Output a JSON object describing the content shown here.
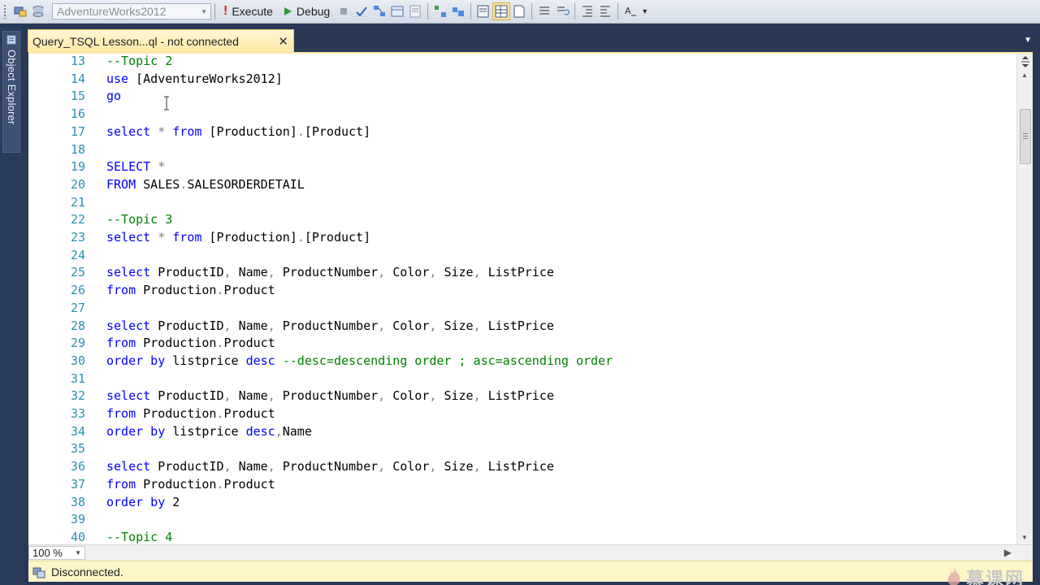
{
  "toolbar": {
    "database_value": "AdventureWorks2012",
    "execute_label": "Execute",
    "debug_label": "Debug"
  },
  "sidebar": {
    "object_explorer_label": "Object Explorer"
  },
  "tab": {
    "title": "Query_TSQL Lesson...ql - not connected",
    "close_glyph": "✕"
  },
  "editor": {
    "lines": [
      {
        "no": "13",
        "tokens": [
          {
            "t": "--Topic 2",
            "c": "cm"
          }
        ]
      },
      {
        "no": "14",
        "tokens": [
          {
            "t": "use",
            "c": "kw"
          },
          {
            "t": " ",
            "c": "tx"
          },
          {
            "t": "[AdventureWorks2012]",
            "c": "tx"
          }
        ]
      },
      {
        "no": "15",
        "tokens": [
          {
            "t": "go",
            "c": "kw"
          }
        ]
      },
      {
        "no": "16",
        "tokens": []
      },
      {
        "no": "17",
        "tokens": [
          {
            "t": "select",
            "c": "kw"
          },
          {
            "t": " * ",
            "c": "gr"
          },
          {
            "t": "from",
            "c": "kw"
          },
          {
            "t": " [Production]",
            "c": "tx"
          },
          {
            "t": ".",
            "c": "gr"
          },
          {
            "t": "[Product]",
            "c": "tx"
          }
        ]
      },
      {
        "no": "18",
        "tokens": []
      },
      {
        "no": "19",
        "tokens": [
          {
            "t": "SELECT",
            "c": "kw"
          },
          {
            "t": " *",
            "c": "gr"
          }
        ]
      },
      {
        "no": "20",
        "tokens": [
          {
            "t": "FROM",
            "c": "kw"
          },
          {
            "t": " SALES",
            "c": "tx"
          },
          {
            "t": ".",
            "c": "gr"
          },
          {
            "t": "SALESORDERDETAIL",
            "c": "tx"
          }
        ]
      },
      {
        "no": "21",
        "tokens": []
      },
      {
        "no": "22",
        "tokens": [
          {
            "t": "--Topic 3",
            "c": "cm"
          }
        ]
      },
      {
        "no": "23",
        "tokens": [
          {
            "t": "select",
            "c": "kw"
          },
          {
            "t": " * ",
            "c": "gr"
          },
          {
            "t": "from",
            "c": "kw"
          },
          {
            "t": " [Production]",
            "c": "tx"
          },
          {
            "t": ".",
            "c": "gr"
          },
          {
            "t": "[Product]",
            "c": "tx"
          }
        ]
      },
      {
        "no": "24",
        "tokens": []
      },
      {
        "no": "25",
        "tokens": [
          {
            "t": "select",
            "c": "kw"
          },
          {
            "t": " ProductID",
            "c": "tx"
          },
          {
            "t": ", ",
            "c": "gr"
          },
          {
            "t": "Name",
            "c": "tx"
          },
          {
            "t": ", ",
            "c": "gr"
          },
          {
            "t": "ProductNumber",
            "c": "tx"
          },
          {
            "t": ", ",
            "c": "gr"
          },
          {
            "t": "Color",
            "c": "tx"
          },
          {
            "t": ", ",
            "c": "gr"
          },
          {
            "t": "Size",
            "c": "tx"
          },
          {
            "t": ", ",
            "c": "gr"
          },
          {
            "t": "ListPrice",
            "c": "tx"
          }
        ]
      },
      {
        "no": "26",
        "tokens": [
          {
            "t": "from",
            "c": "kw"
          },
          {
            "t": " Production",
            "c": "tx"
          },
          {
            "t": ".",
            "c": "gr"
          },
          {
            "t": "Product",
            "c": "tx"
          }
        ]
      },
      {
        "no": "27",
        "tokens": []
      },
      {
        "no": "28",
        "tokens": [
          {
            "t": "select",
            "c": "kw"
          },
          {
            "t": " ProductID",
            "c": "tx"
          },
          {
            "t": ", ",
            "c": "gr"
          },
          {
            "t": "Name",
            "c": "tx"
          },
          {
            "t": ", ",
            "c": "gr"
          },
          {
            "t": "ProductNumber",
            "c": "tx"
          },
          {
            "t": ", ",
            "c": "gr"
          },
          {
            "t": "Color",
            "c": "tx"
          },
          {
            "t": ", ",
            "c": "gr"
          },
          {
            "t": "Size",
            "c": "tx"
          },
          {
            "t": ", ",
            "c": "gr"
          },
          {
            "t": "ListPrice",
            "c": "tx"
          }
        ]
      },
      {
        "no": "29",
        "tokens": [
          {
            "t": "from",
            "c": "kw"
          },
          {
            "t": " Production",
            "c": "tx"
          },
          {
            "t": ".",
            "c": "gr"
          },
          {
            "t": "Product",
            "c": "tx"
          }
        ]
      },
      {
        "no": "30",
        "tokens": [
          {
            "t": "order by",
            "c": "kw"
          },
          {
            "t": " listprice ",
            "c": "tx"
          },
          {
            "t": "desc",
            "c": "kw"
          },
          {
            "t": " --desc=descending order ; asc=ascending order",
            "c": "cm"
          }
        ]
      },
      {
        "no": "31",
        "tokens": []
      },
      {
        "no": "32",
        "tokens": [
          {
            "t": "select",
            "c": "kw"
          },
          {
            "t": " ProductID",
            "c": "tx"
          },
          {
            "t": ", ",
            "c": "gr"
          },
          {
            "t": "Name",
            "c": "tx"
          },
          {
            "t": ", ",
            "c": "gr"
          },
          {
            "t": "ProductNumber",
            "c": "tx"
          },
          {
            "t": ", ",
            "c": "gr"
          },
          {
            "t": "Color",
            "c": "tx"
          },
          {
            "t": ", ",
            "c": "gr"
          },
          {
            "t": "Size",
            "c": "tx"
          },
          {
            "t": ", ",
            "c": "gr"
          },
          {
            "t": "ListPrice",
            "c": "tx"
          }
        ]
      },
      {
        "no": "33",
        "tokens": [
          {
            "t": "from",
            "c": "kw"
          },
          {
            "t": " Production",
            "c": "tx"
          },
          {
            "t": ".",
            "c": "gr"
          },
          {
            "t": "Product",
            "c": "tx"
          }
        ]
      },
      {
        "no": "34",
        "tokens": [
          {
            "t": "order by",
            "c": "kw"
          },
          {
            "t": " listprice ",
            "c": "tx"
          },
          {
            "t": "desc",
            "c": "kw"
          },
          {
            "t": ",",
            "c": "gr"
          },
          {
            "t": "Name",
            "c": "tx"
          }
        ]
      },
      {
        "no": "35",
        "tokens": []
      },
      {
        "no": "36",
        "tokens": [
          {
            "t": "select",
            "c": "kw"
          },
          {
            "t": " ProductID",
            "c": "tx"
          },
          {
            "t": ", ",
            "c": "gr"
          },
          {
            "t": "Name",
            "c": "tx"
          },
          {
            "t": ", ",
            "c": "gr"
          },
          {
            "t": "ProductNumber",
            "c": "tx"
          },
          {
            "t": ", ",
            "c": "gr"
          },
          {
            "t": "Color",
            "c": "tx"
          },
          {
            "t": ", ",
            "c": "gr"
          },
          {
            "t": "Size",
            "c": "tx"
          },
          {
            "t": ", ",
            "c": "gr"
          },
          {
            "t": "ListPrice",
            "c": "tx"
          }
        ]
      },
      {
        "no": "37",
        "tokens": [
          {
            "t": "from",
            "c": "kw"
          },
          {
            "t": " Production",
            "c": "tx"
          },
          {
            "t": ".",
            "c": "gr"
          },
          {
            "t": "Product",
            "c": "tx"
          }
        ]
      },
      {
        "no": "38",
        "tokens": [
          {
            "t": "order by",
            "c": "kw"
          },
          {
            "t": " 2",
            "c": "tx"
          }
        ]
      },
      {
        "no": "39",
        "tokens": []
      },
      {
        "no": "40",
        "tokens": [
          {
            "t": "--Topic 4",
            "c": "cm"
          }
        ]
      }
    ]
  },
  "zoom": {
    "value": "100 %"
  },
  "status": {
    "text": "Disconnected."
  },
  "watermark": {
    "text": "慕课网"
  },
  "colors": {
    "keyword": "#0000ff",
    "comment": "#008000",
    "operator": "#808080",
    "identifier": "#000000",
    "line_number": "#2b91af",
    "tab_active": "#ffe8a6",
    "status_bar": "#fff6c8",
    "chrome": "#293955"
  }
}
